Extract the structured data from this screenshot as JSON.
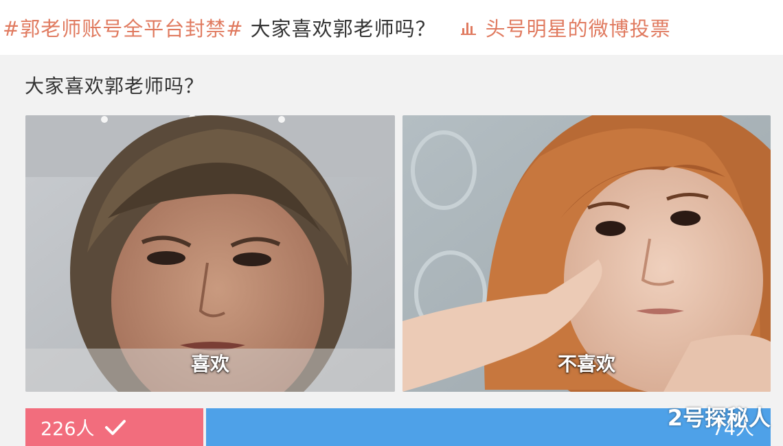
{
  "header": {
    "hashtag": "#郭老师账号全平台封禁#",
    "topic": "大家喜欢郭老师吗？",
    "rank_text": "头号明星的微博投票",
    "rank_icon": "bar-chart-icon"
  },
  "poll": {
    "question": "大家喜欢郭老师吗？",
    "options": [
      {
        "label": "喜欢",
        "photo": "frowning-woman-photo"
      },
      {
        "label": "不喜欢",
        "photo": "saluting-woman-photo"
      }
    ],
    "results": {
      "left_count": "226人",
      "left_icon": "checkmark-icon",
      "right_count": "74人",
      "left_color": "#f26d7d",
      "right_color": "#4ea1e8"
    }
  },
  "watermark": "2号探秘人"
}
